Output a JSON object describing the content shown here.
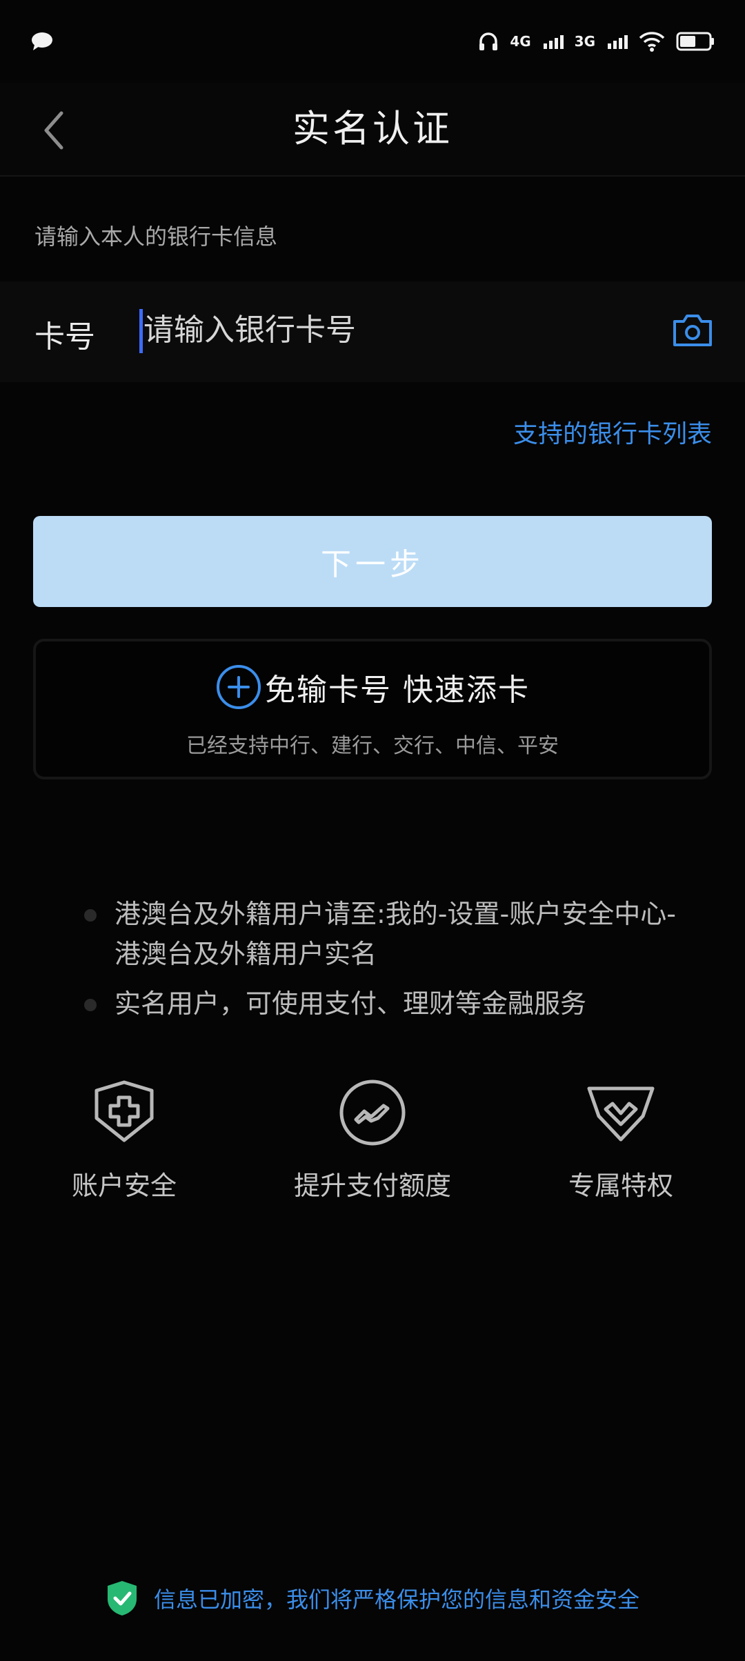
{
  "colors": {
    "background": "#050505",
    "accent": "#3b8eea",
    "button_disabled": "#bcdcf6",
    "shield_green": "#27b873"
  },
  "status_bar": {
    "network_1": "4G",
    "network_2": "3G",
    "icons": [
      "chat-bubble-icon",
      "headphone-icon",
      "signal-icon",
      "wifi-icon",
      "battery-icon"
    ]
  },
  "header": {
    "title": "实名认证",
    "back_icon": "chevron-left-icon"
  },
  "form": {
    "hint": "请输入本人的银行卡信息",
    "card_label": "卡号",
    "card_value": "",
    "card_placeholder": "请输入银行卡号",
    "camera_icon": "camera-icon",
    "bank_list_link": "支持的银行卡列表",
    "next_button": "下一步"
  },
  "quick_add": {
    "icon": "plus-circle-icon",
    "title": "免输卡号  快速添卡",
    "subtitle": "已经支持中行、建行、交行、中信、平安"
  },
  "notes": [
    "港澳台及外籍用户请至:我的-设置-账户安全中心-港澳台及外籍用户实名",
    "实名用户，可使用支付、理财等金融服务"
  ],
  "features": [
    {
      "label": "账户安全",
      "icon": "shield-plus-icon"
    },
    {
      "label": "提升支付额度",
      "icon": "payment-limit-icon"
    },
    {
      "label": "专属特权",
      "icon": "diamond-badge-icon"
    }
  ],
  "footer": {
    "icon": "shield-check-icon",
    "text": "信息已加密，我们将严格保护您的信息和资金安全"
  }
}
